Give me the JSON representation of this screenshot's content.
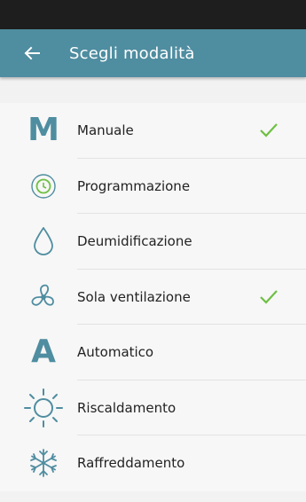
{
  "header": {
    "title": "Scegli modalità",
    "back_icon": "arrow-left-icon"
  },
  "colors": {
    "accent": "#4f8da0",
    "check": "#6fbf44",
    "status_bar": "#1e1e1e"
  },
  "modes": [
    {
      "label": "Manuale",
      "icon": "letter-m-icon",
      "icon_text": "M",
      "checked": true
    },
    {
      "label": "Programmazione",
      "icon": "clock-icon",
      "checked": false
    },
    {
      "label": "Deumidificazione",
      "icon": "water-drop-icon",
      "checked": false
    },
    {
      "label": "Sola ventilazione",
      "icon": "fan-icon",
      "checked": true
    },
    {
      "label": "Automatico",
      "icon": "letter-a-icon",
      "icon_text": "A",
      "checked": false
    },
    {
      "label": "Riscaldamento",
      "icon": "sun-icon",
      "checked": false
    },
    {
      "label": "Raffreddamento",
      "icon": "snowflake-icon",
      "checked": false
    }
  ]
}
